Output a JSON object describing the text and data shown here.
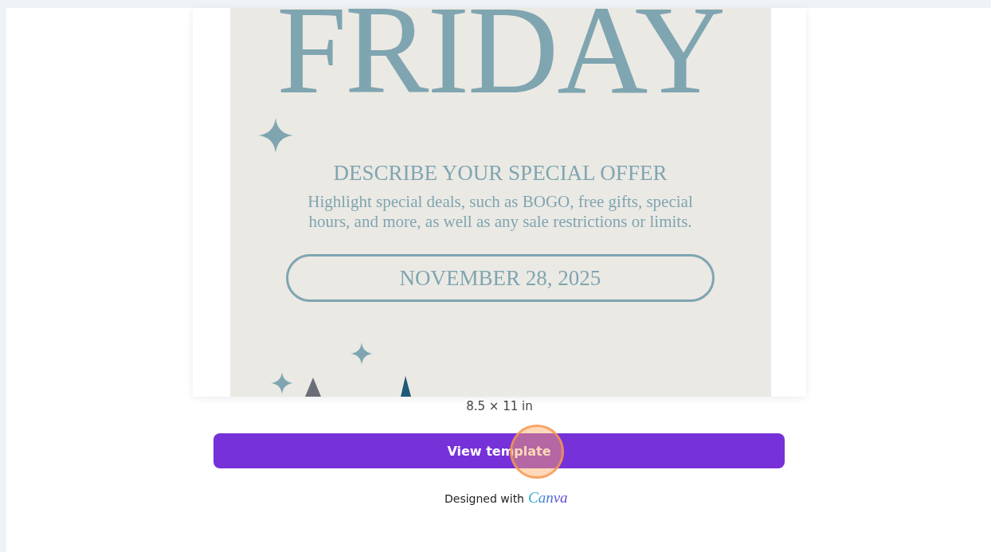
{
  "flyer": {
    "headline": "FRIDAY",
    "subheading": "DESCRIBE YOUR SPECIAL OFFER",
    "body": "Highlight special deals, such as BOGO, free gifts, special hours, and more, as well as any sale restrictions or limits.",
    "date": "NOVEMBER 28, 2025"
  },
  "size_label": "8.5 × 11 in",
  "button": {
    "label": "View template"
  },
  "credit": {
    "text": "Designed with",
    "brand": "Canva"
  }
}
